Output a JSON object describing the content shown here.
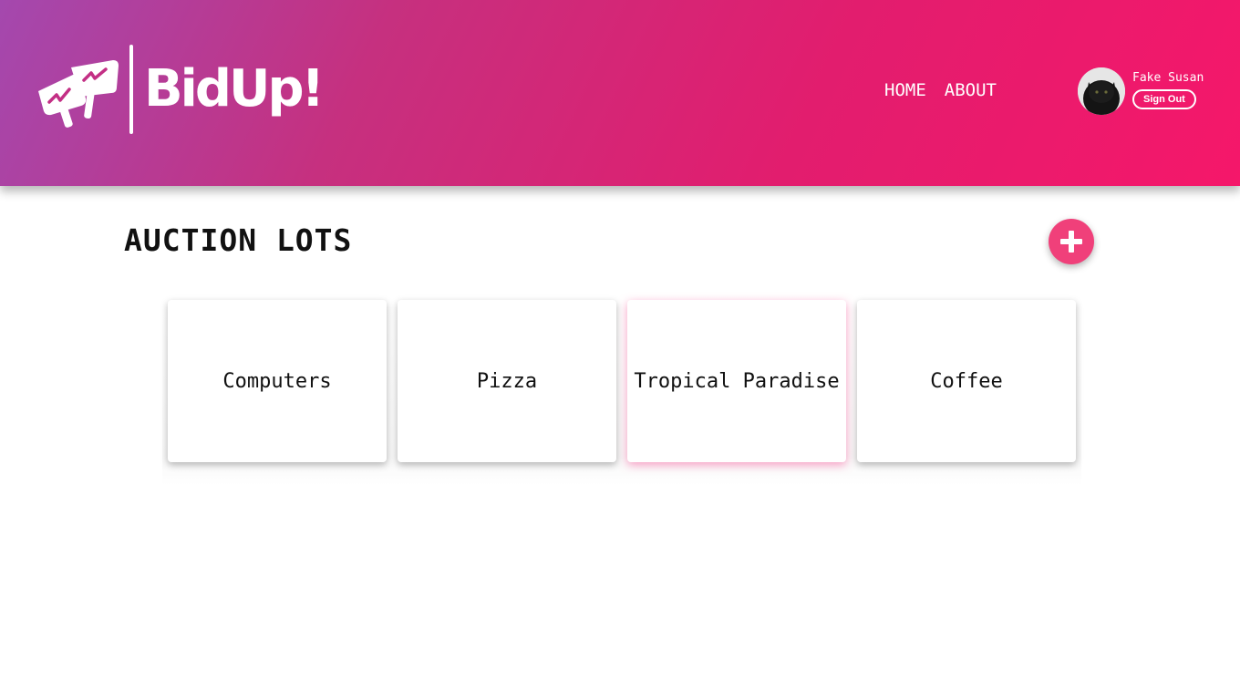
{
  "header": {
    "logo_text": "BidUp!",
    "nav": [
      {
        "label": "HOME"
      },
      {
        "label": "ABOUT"
      }
    ],
    "user": {
      "name": "Fake Susan",
      "signout_label": "Sign Out"
    }
  },
  "main": {
    "title": "AUCTION LOTS",
    "add_icon": "plus-icon",
    "lots": [
      {
        "title": "Computers"
      },
      {
        "title": "Pizza"
      },
      {
        "title": "Tropical Paradise"
      },
      {
        "title": "Coffee"
      }
    ]
  },
  "colors": {
    "header_gradient_start": "#a448ae",
    "header_gradient_end": "#f5176a",
    "accent": "#f0407a"
  }
}
